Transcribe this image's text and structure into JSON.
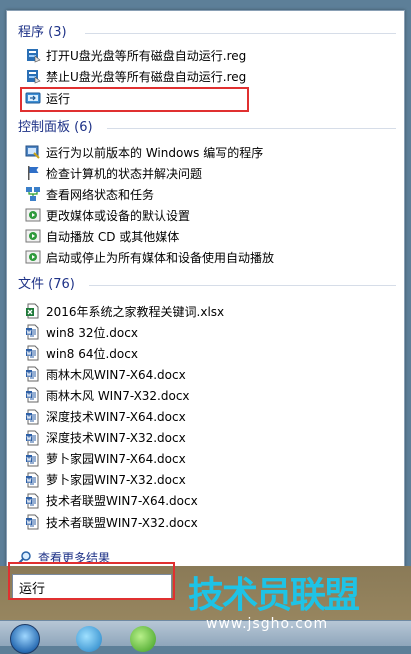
{
  "sections": {
    "programs": {
      "title": "程序 (3)",
      "items": [
        {
          "label": "打开U盘光盘等所有磁盘自动运行.reg",
          "icon": "registry-icon"
        },
        {
          "label": "禁止U盘光盘等所有磁盘自动运行.reg",
          "icon": "registry-icon"
        },
        {
          "label": "运行",
          "icon": "run-icon"
        }
      ]
    },
    "control_panel": {
      "title": "控制面板 (6)",
      "items": [
        {
          "label": "运行为以前版本的 Windows 编写的程序",
          "icon": "compatibility-icon"
        },
        {
          "label": "检查计算机的状态并解决问题",
          "icon": "flag-icon"
        },
        {
          "label": "查看网络状态和任务",
          "icon": "network-icon"
        },
        {
          "label": "更改媒体或设备的默认设置",
          "icon": "autoplay-icon"
        },
        {
          "label": "自动播放 CD 或其他媒体",
          "icon": "autoplay-icon"
        },
        {
          "label": "启动或停止为所有媒体和设备使用自动播放",
          "icon": "autoplay-icon"
        }
      ]
    },
    "files": {
      "title": "文件 (76)",
      "items": [
        {
          "label": "2016年系统之家教程关键词.xlsx",
          "icon": "excel-file-icon"
        },
        {
          "label": "win8 32位.docx",
          "icon": "word-file-icon"
        },
        {
          "label": "win8 64位.docx",
          "icon": "word-file-icon"
        },
        {
          "label": "雨林木风WIN7-X64.docx",
          "icon": "word-file-icon"
        },
        {
          "label": "雨林木风 WIN7-X32.docx",
          "icon": "word-file-icon"
        },
        {
          "label": "深度技术WIN7-X64.docx",
          "icon": "word-file-icon"
        },
        {
          "label": "深度技术WIN7-X32.docx",
          "icon": "word-file-icon"
        },
        {
          "label": "萝卜家园WIN7-X64.docx",
          "icon": "word-file-icon"
        },
        {
          "label": "萝卜家园WIN7-X32.docx",
          "icon": "word-file-icon"
        },
        {
          "label": "技术者联盟WIN7-X64.docx",
          "icon": "word-file-icon"
        },
        {
          "label": "技术者联盟WIN7-X32.docx",
          "icon": "word-file-icon"
        }
      ]
    }
  },
  "see_more": "查看更多结果",
  "search": {
    "value": "运行"
  },
  "watermark": {
    "logo": "技术员联盟",
    "url": "www.jsgho.com"
  },
  "colors": {
    "highlight": "#e03030",
    "section_title": "#1e3287",
    "logo": "#1ec3e6"
  }
}
